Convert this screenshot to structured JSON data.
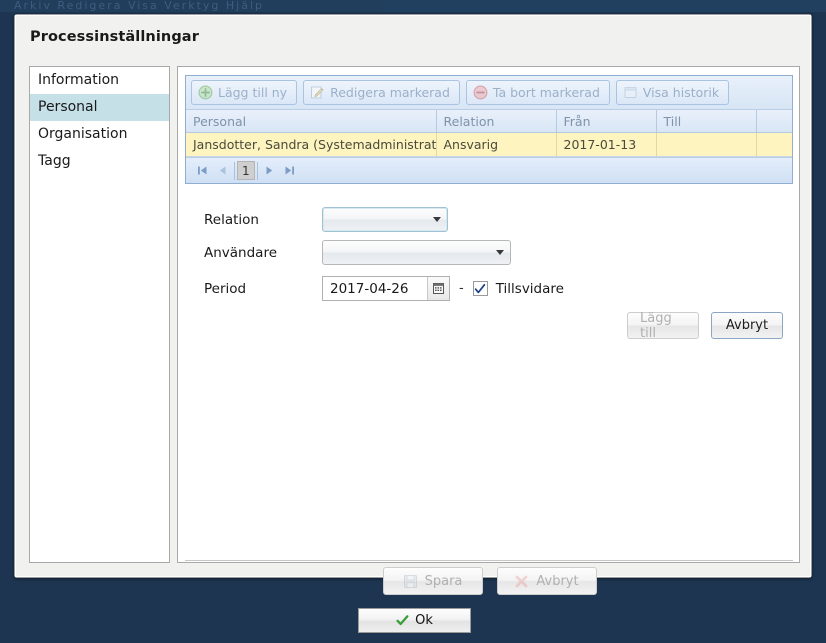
{
  "window": {
    "menu_strip_text": "Arkiv   Redigera   Visa   Verktyg   Hjälp"
  },
  "dialog": {
    "title": "Processinställningar"
  },
  "sidebar": {
    "items": [
      {
        "label": "Information",
        "selected": false
      },
      {
        "label": "Personal",
        "selected": true
      },
      {
        "label": "Organisation",
        "selected": false
      },
      {
        "label": "Tagg",
        "selected": false
      }
    ]
  },
  "grid": {
    "toolbar": [
      {
        "label": "Lägg till ny",
        "icon": "add-circle-icon",
        "disabled": true
      },
      {
        "label": "Redigera markerad",
        "icon": "edit-pencil-icon",
        "disabled": true
      },
      {
        "label": "Ta bort markerad",
        "icon": "remove-circle-icon",
        "disabled": true
      },
      {
        "label": "Visa historik",
        "icon": "history-window-icon",
        "disabled": true
      }
    ],
    "columns": [
      "Personal",
      "Relation",
      "Från",
      "Till",
      ""
    ],
    "rows": [
      {
        "personal": "Jansdotter, Sandra (Systemadministratör)",
        "relation": "Ansvarig",
        "fran": "2017-01-13",
        "till": "",
        "extra": ""
      }
    ],
    "pager": {
      "first_icon": "go-first-icon",
      "prev_icon": "go-prev-icon",
      "page": "1",
      "next_icon": "go-next-icon",
      "last_icon": "go-last-icon"
    }
  },
  "form": {
    "relation_label": "Relation",
    "relation_value": "",
    "anvandare_label": "Användare",
    "anvandare_value": "",
    "period_label": "Period",
    "period_from": "2017-04-26",
    "period_separator": "-",
    "calendar_icon": "calendar-icon",
    "tillsvidare_label": "Tillsvidare",
    "tillsvidare_checked": true,
    "add_label": "Lägg till",
    "cancel_label": "Avbryt"
  },
  "footer": {
    "save_label": "Spara",
    "save_icon": "floppy-disk-icon",
    "cancel_label": "Avbryt",
    "cancel_icon": "red-cross-icon"
  },
  "ok_bar": {
    "ok_label": "Ok",
    "ok_icon": "green-check-icon"
  },
  "colors": {
    "app_background": "#1d3551",
    "dialog_background": "#f1f1f0",
    "selected_nav": "#c6e0e8",
    "grid_header": "#dde9f6",
    "row_highlight": "#fdf4bf",
    "grid_border": "#8faed0"
  }
}
